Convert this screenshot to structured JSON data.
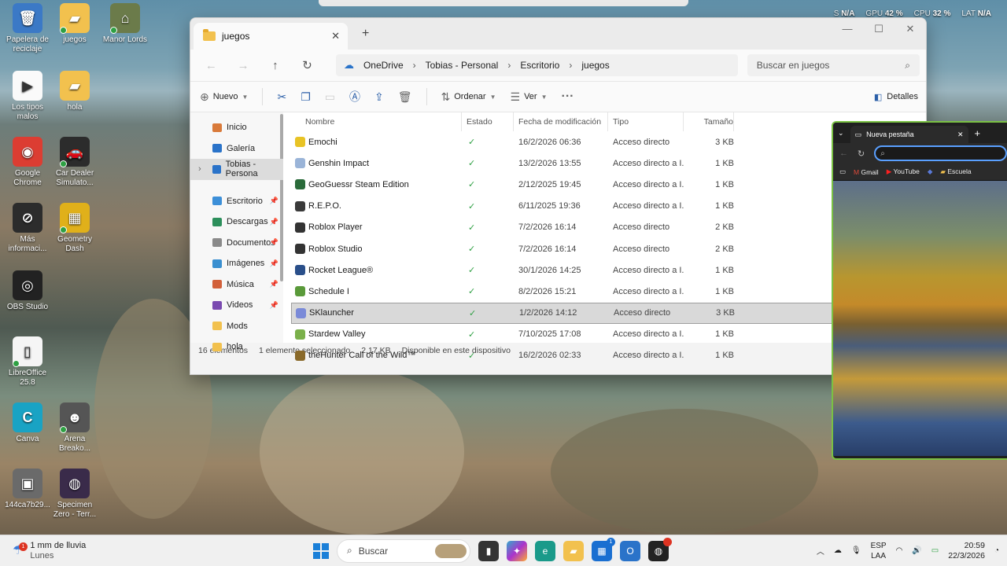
{
  "hud": {
    "s_label": "S",
    "s_val": "N/A",
    "gpu_label": "GPU",
    "gpu_val": "42 %",
    "cpu_label": "CPU",
    "cpu_val": "32 %",
    "lat_label": "LAT",
    "lat_val": "N/A"
  },
  "desktop": {
    "icons": [
      {
        "label": "Papelera de reciclaje",
        "color": "#3b79c6",
        "glyph": "🗑"
      },
      {
        "label": "juegos",
        "color": "#f2c14e",
        "glyph": "▰"
      },
      {
        "label": "Manor Lords",
        "color": "#6b7b4a",
        "glyph": "⌂"
      },
      {
        "label": "Los tipos malos",
        "color": "#fafafa",
        "glyph": "▶"
      },
      {
        "label": "hola",
        "color": "#f2c14e",
        "glyph": "▰"
      },
      {
        "label": "Google Chrome",
        "color": "#dc3d32",
        "glyph": "◉"
      },
      {
        "label": "Car Dealer Simulato...",
        "color": "#2c2c2c",
        "glyph": "🚗"
      },
      {
        "label": "Más informaci...",
        "color": "#2c2c2c",
        "glyph": "⊘"
      },
      {
        "label": "Geometry Dash",
        "color": "#e0b01a",
        "glyph": "▦"
      },
      {
        "label": "OBS Studio",
        "color": "#222222",
        "glyph": "◎"
      },
      {
        "label": "LibreOffice 25.8",
        "color": "#f5f5f5",
        "glyph": "▯"
      },
      {
        "label": "Canva",
        "color": "#19a3c4",
        "glyph": "C"
      },
      {
        "label": "Arena Breako...",
        "color": "#555555",
        "glyph": "☻"
      },
      {
        "label": "144ca7b29...",
        "color": "#6a6a6a",
        "glyph": "▣"
      },
      {
        "label": "Specimen Zero - Terr...",
        "color": "#3a2b4a",
        "glyph": "◍"
      }
    ]
  },
  "explorer": {
    "tab_title": "juegos",
    "breadcrumb": [
      "OneDrive",
      "Tobias - Personal",
      "Escritorio",
      "juegos"
    ],
    "search_placeholder": "Buscar en juegos",
    "toolbar": {
      "new": "Nuevo",
      "sort": "Ordenar",
      "view": "Ver",
      "details": "Detalles"
    },
    "sidebar": [
      {
        "label": "Inicio",
        "color": "#d97a3a",
        "pin": false,
        "sel": false
      },
      {
        "label": "Galería",
        "color": "#2a73c9",
        "pin": false,
        "sel": false
      },
      {
        "label": "Tobias - Persona",
        "color": "#2a73c9",
        "pin": false,
        "sel": true
      },
      {
        "label": "Escritorio",
        "color": "#3c8fd8",
        "pin": true,
        "sel": false
      },
      {
        "label": "Descargas",
        "color": "#2c8f5b",
        "pin": true,
        "sel": false
      },
      {
        "label": "Documentos",
        "color": "#8a8a8a",
        "pin": true,
        "sel": false
      },
      {
        "label": "Imágenes",
        "color": "#3a8fd0",
        "pin": true,
        "sel": false
      },
      {
        "label": "Música",
        "color": "#d2603a",
        "pin": true,
        "sel": false
      },
      {
        "label": "Videos",
        "color": "#7a4ab0",
        "pin": true,
        "sel": false
      },
      {
        "label": "Mods",
        "color": "#f2c14e",
        "pin": false,
        "sel": false
      },
      {
        "label": "hola",
        "color": "#f2c14e",
        "pin": false,
        "sel": false
      }
    ],
    "columns": [
      "Nombre",
      "Estado",
      "Fecha de modificación",
      "Tipo",
      "Tamaño"
    ],
    "files": [
      {
        "name": "Emochi",
        "date": "16/2/2026 06:36",
        "type": "Acceso directo",
        "size": "3 KB",
        "color": "#e8c325"
      },
      {
        "name": "Genshin Impact",
        "date": "13/2/2026 13:55",
        "type": "Acceso directo a I...",
        "size": "1 KB",
        "color": "#9ab4d8"
      },
      {
        "name": "GeoGuessr Steam Edition",
        "date": "2/12/2025 19:45",
        "type": "Acceso directo a I...",
        "size": "1 KB",
        "color": "#2a6b3a"
      },
      {
        "name": "R.E.P.O.",
        "date": "6/11/2025 19:36",
        "type": "Acceso directo a I...",
        "size": "1 KB",
        "color": "#3a3a3a"
      },
      {
        "name": "Roblox Player",
        "date": "7/2/2026 16:14",
        "type": "Acceso directo",
        "size": "2 KB",
        "color": "#333333"
      },
      {
        "name": "Roblox Studio",
        "date": "7/2/2026 16:14",
        "type": "Acceso directo",
        "size": "2 KB",
        "color": "#333333"
      },
      {
        "name": "Rocket League®",
        "date": "30/1/2026 14:25",
        "type": "Acceso directo a I...",
        "size": "1 KB",
        "color": "#2a4f8a"
      },
      {
        "name": "Schedule I",
        "date": "8/2/2026 15:21",
        "type": "Acceso directo a I...",
        "size": "1 KB",
        "color": "#5a9a3a"
      },
      {
        "name": "SKlauncher",
        "date": "1/2/2026 14:12",
        "type": "Acceso directo",
        "size": "3 KB",
        "color": "#7a8ad8"
      },
      {
        "name": "Stardew Valley",
        "date": "7/10/2025 17:08",
        "type": "Acceso directo a I...",
        "size": "1 KB",
        "color": "#7ab04a"
      },
      {
        "name": "theHunter Call of the Wild™",
        "date": "16/2/2026 02:33",
        "type": "Acceso directo a I...",
        "size": "1 KB",
        "color": "#8a6a2a"
      }
    ],
    "selected_file": "SKlauncher",
    "status": {
      "count": "16 elementos",
      "selection": "1 elemento seleccionado",
      "size": "2,17 KB",
      "availability": "Disponible en este dispositivo"
    }
  },
  "browser": {
    "tab_title": "Nueva pestaña",
    "bookmarks": [
      "Gmail",
      "YouTube",
      "Escuela"
    ]
  },
  "taskbar": {
    "weather_title": "1 mm de lluvia",
    "weather_sub": "Lunes",
    "weather_badge": "1",
    "search_label": "Buscar",
    "lang_top": "ESP",
    "lang_bottom": "LAA",
    "time": "20:59",
    "date": "22/3/2026",
    "store_badge": "1"
  }
}
